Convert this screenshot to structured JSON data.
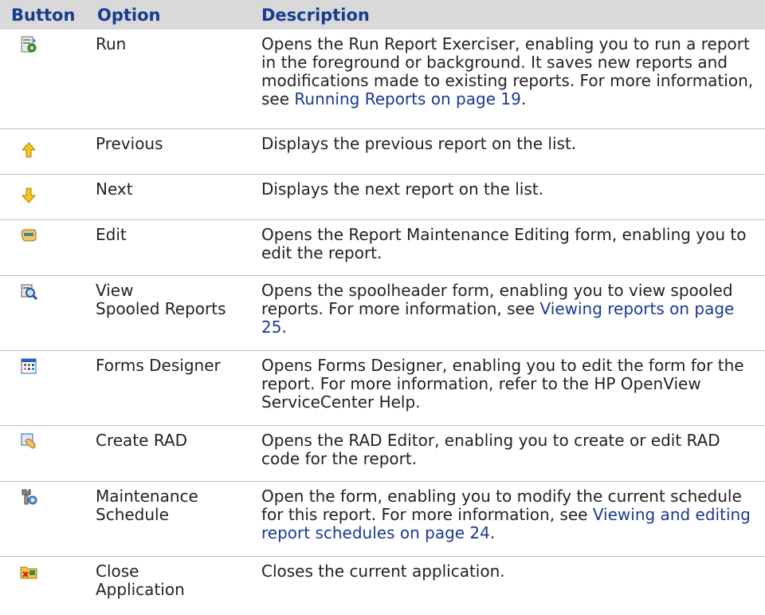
{
  "header": {
    "button": "Button",
    "option": "Option",
    "description": "Description"
  },
  "rows": [
    {
      "icon": "run-report-icon",
      "option": "Run",
      "desc_parts": [
        "Opens the Run Report Exerciser, enabling you to run a report in the foreground or background. It saves new reports and modifications made to existing reports. For more information, see ",
        "Running Reports on page 19",
        "."
      ]
    },
    {
      "icon": "arrow-up-icon",
      "option": "Previous",
      "desc_parts": [
        "Displays the previous report on the list."
      ]
    },
    {
      "icon": "arrow-down-icon",
      "option": "Next",
      "desc_parts": [
        "Displays the next report on the list."
      ]
    },
    {
      "icon": "edit-hand-icon",
      "option": "Edit",
      "desc_parts": [
        "Opens the Report Maintenance Editing form, enabling you to edit the report."
      ]
    },
    {
      "icon": "view-spooled-icon",
      "option": "View\nSpooled Reports",
      "desc_parts": [
        "Opens the spoolheader form, enabling you to view spooled reports. For more information, see ",
        "Viewing reports on page 25",
        "."
      ]
    },
    {
      "icon": "forms-designer-icon",
      "option": "Forms Designer",
      "desc_parts": [
        "Opens Forms Designer, enabling you to edit the form for the report. For more information, refer to the HP OpenView ServiceCenter Help."
      ]
    },
    {
      "icon": "create-rad-icon",
      "option": "Create RAD",
      "desc_parts": [
        "Opens the RAD Editor, enabling you to create or edit RAD code for the report."
      ]
    },
    {
      "icon": "maintenance-schedule-icon",
      "option": "Maintenance\nSchedule",
      "desc_parts": [
        "Open the form, enabling you to modify the current schedule for this report. For more information, see ",
        "Viewing and editing report schedules on page 24",
        "."
      ]
    },
    {
      "icon": "close-application-icon",
      "option": "Close\nApplication",
      "desc_parts": [
        "Closes the current application."
      ]
    }
  ]
}
